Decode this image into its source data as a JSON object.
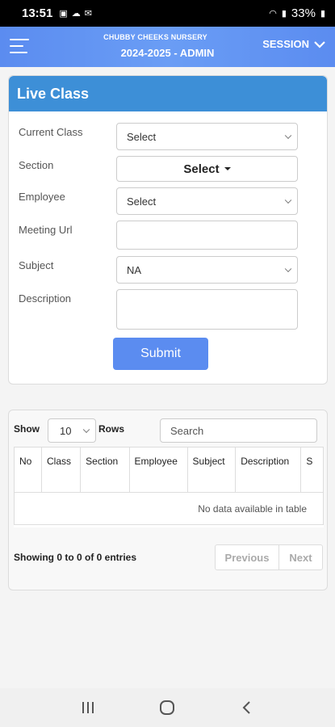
{
  "status_bar": {
    "time": "13:51",
    "battery": "33%"
  },
  "header": {
    "school_name": "CHUBBY CHEEKS NURSERY",
    "session_year": "2024-2025 - ADMIN",
    "session_label": "SESSION",
    "accent_color": "#5b8cf0"
  },
  "live_class": {
    "title": "Live Class",
    "header_color": "#3d8fd7",
    "fields": {
      "current_class": {
        "label": "Current Class",
        "value": "Select"
      },
      "section": {
        "label": "Section",
        "value": "Select"
      },
      "employee": {
        "label": "Employee",
        "value": "Select"
      },
      "meeting_url": {
        "label": "Meeting Url",
        "value": ""
      },
      "subject": {
        "label": "Subject",
        "value": "NA"
      },
      "description": {
        "label": "Description",
        "value": ""
      }
    },
    "submit_label": "Submit"
  },
  "table": {
    "show_label": "Show",
    "length_value": "10",
    "rows_label": "Rows",
    "search_placeholder": "Search",
    "columns": [
      "No",
      "Class",
      "Section",
      "Employee",
      "Subject",
      "Description",
      "S"
    ],
    "empty_message": "No data available in table",
    "info": "Showing 0 to 0 of 0 entries",
    "prev_label": "Previous",
    "next_label": "Next"
  },
  "icons": {
    "menu": "hamburger-icon",
    "session": "chevron-down-icon",
    "nav_recent": "recent-apps-icon",
    "nav_home": "home-icon",
    "nav_back": "back-icon"
  }
}
